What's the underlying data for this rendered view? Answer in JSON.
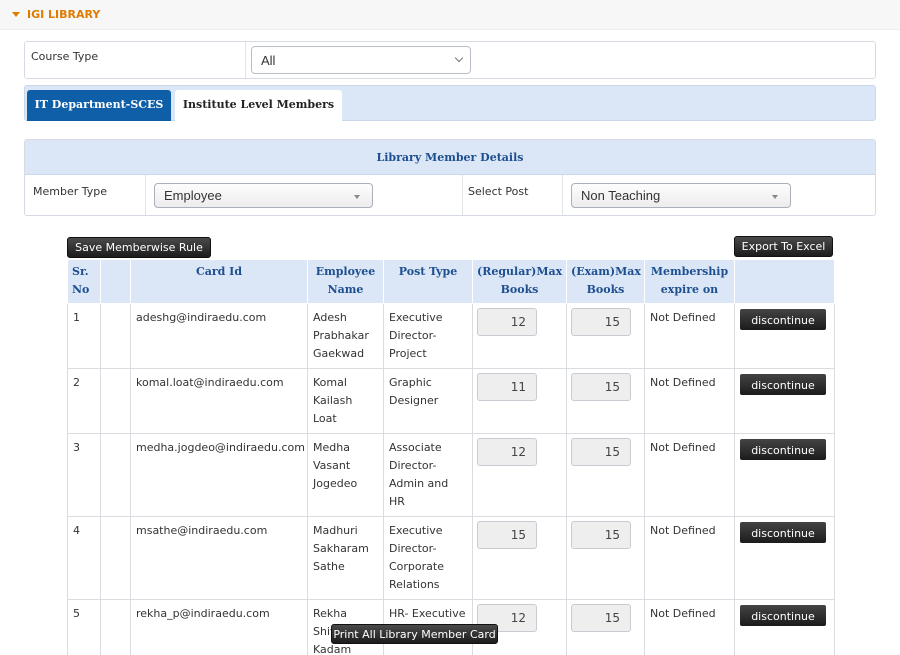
{
  "header": {
    "title": "IGI LIBRARY"
  },
  "filter": {
    "course_type_label": "Course Type",
    "course_type_value": "All"
  },
  "tabs": [
    {
      "label": "IT Department-SCES",
      "active": true
    },
    {
      "label": "Institute Level Members",
      "active": false
    }
  ],
  "details": {
    "heading": "Library Member Details",
    "member_type_label": "Member Type",
    "member_type_value": "Employee",
    "select_post_label": "Select Post",
    "select_post_value": "Non Teaching"
  },
  "buttons": {
    "save_rule": "Save Memberwise Rule",
    "export": "Export To Excel",
    "print_all": "Print All Library Member Card"
  },
  "table": {
    "headers": [
      "Sr. No",
      "",
      "Card Id",
      "Employee Name",
      "Post Type",
      "(Regular)Max Books",
      "(Exam)Max Books",
      "Membership expire on",
      ""
    ],
    "rows": [
      {
        "sr": "1",
        "card": "adeshg@indiraedu.com",
        "name": "Adesh Prabhakar Gaekwad",
        "post": "Executive Director-Project",
        "regular": "12",
        "exam": "15",
        "expire": "Not Defined",
        "action": "discontinue"
      },
      {
        "sr": "2",
        "card": "komal.loat@indiraedu.com",
        "name": "Komal Kailash Loat",
        "post": "Graphic Designer",
        "regular": "11",
        "exam": "15",
        "expire": "Not Defined",
        "action": "discontinue"
      },
      {
        "sr": "3",
        "card": "medha.jogdeo@indiraedu.com",
        "name": "Medha Vasant Jogedeo",
        "post": "Associate Director-Admin and HR",
        "regular": "12",
        "exam": "15",
        "expire": "Not Defined",
        "action": "discontinue"
      },
      {
        "sr": "4",
        "card": "msathe@indiraedu.com",
        "name": "Madhuri Sakharam Sathe",
        "post": "Executive Director-Corporate Relations",
        "regular": "15",
        "exam": "15",
        "expire": "Not Defined",
        "action": "discontinue"
      },
      {
        "sr": "5",
        "card": "rekha_p@indiraedu.com",
        "name": "Rekha Shivaji Kadam",
        "post": "HR- Executive",
        "regular": "12",
        "exam": "15",
        "expire": "Not Defined",
        "action": "discontinue"
      }
    ]
  },
  "colors": {
    "accent": "#e07b00",
    "tab_active": "#0f5fa8",
    "header_bg": "#dbe7f7"
  }
}
